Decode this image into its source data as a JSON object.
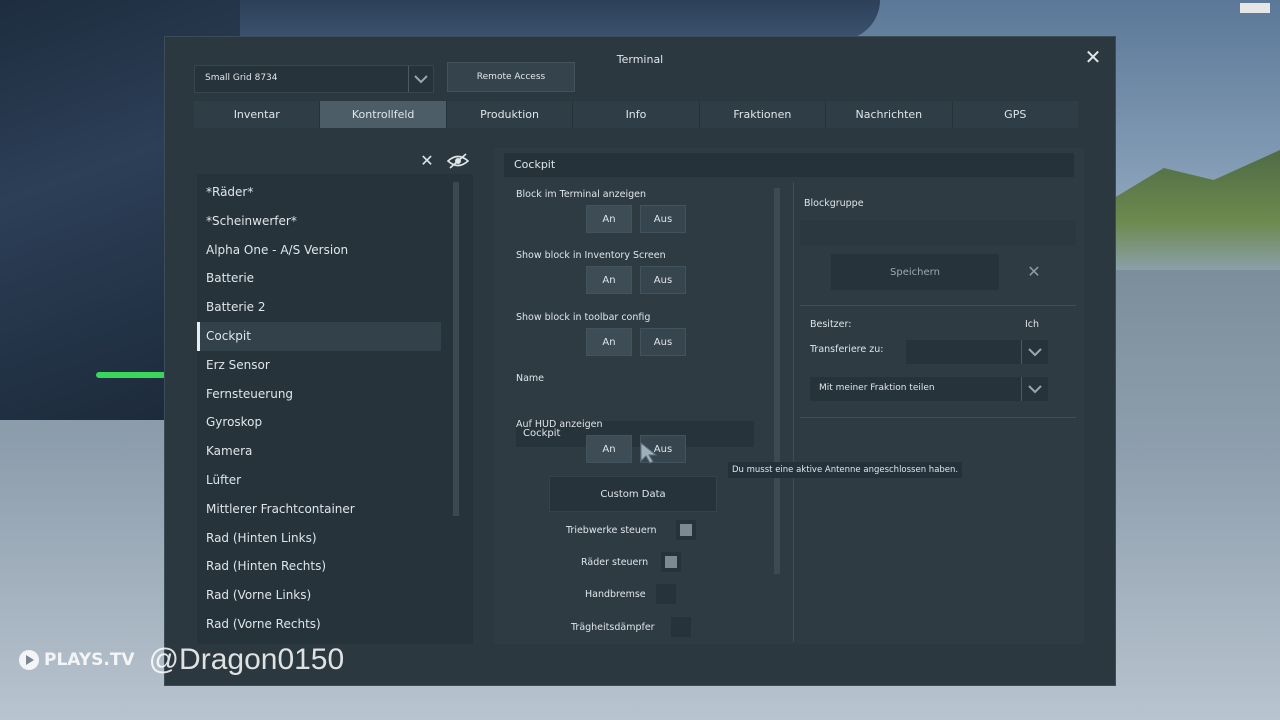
{
  "window": {
    "title": "Terminal"
  },
  "grid_select": {
    "value": "Small Grid 8734"
  },
  "remote_access": "Remote Access",
  "tabs": [
    {
      "label": "Inventar"
    },
    {
      "label": "Kontrollfeld"
    },
    {
      "label": "Produktion"
    },
    {
      "label": "Info"
    },
    {
      "label": "Fraktionen"
    },
    {
      "label": "Nachrichten"
    },
    {
      "label": "GPS"
    }
  ],
  "active_tab": "Kontrollfeld",
  "block_list": [
    "*Räder*",
    "*Scheinwerfer*",
    "Alpha One - A/S Version",
    "Batterie",
    "Batterie 2",
    "Cockpit",
    "Erz Sensor",
    "Fernsteuerung",
    "Gyroskop",
    "Kamera",
    "Lüfter",
    "Mittlerer Frachtcontainer",
    "Rad (Hinten Links)",
    "Rad (Hinten Rechts)",
    "Rad (Vorne Links)",
    "Rad (Vorne Rechts)"
  ],
  "selected_block": "Cockpit",
  "detail": {
    "header": "Cockpit",
    "show_terminal": {
      "label": "Block im Terminal anzeigen",
      "on": "An",
      "off": "Aus"
    },
    "show_inventory": {
      "label": "Show block in Inventory Screen",
      "on": "An",
      "off": "Aus"
    },
    "show_toolbar": {
      "label": "Show block in toolbar config",
      "on": "An",
      "off": "Aus"
    },
    "name_label": "Name",
    "name_value": "Cockpit",
    "show_hud": {
      "label": "Auf HUD anzeigen",
      "on": "An",
      "off": "Aus"
    },
    "custom_data": "Custom Data",
    "thrusters": "Triebwerke steuern",
    "wheels": "Räder steuern",
    "handbrake": "Handbremse",
    "dampeners": "Trägheitsdämpfer",
    "tooltip": "Du musst eine aktive Antenne angeschlossen haben."
  },
  "side": {
    "blockgroup_label": "Blockgruppe",
    "save": "Speichern",
    "owner_label": "Besitzer:",
    "owner_value": "Ich",
    "transfer_label": "Transferiere zu:",
    "share_value": "Mit meiner Fraktion teilen"
  },
  "watermark": {
    "brand": "PLAYS.TV",
    "handle": "@Dragon0150"
  }
}
